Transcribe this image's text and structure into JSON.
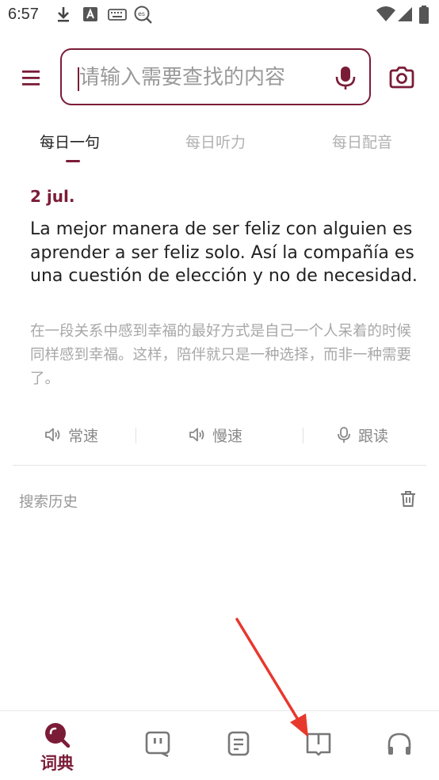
{
  "status_bar": {
    "time": "6:57"
  },
  "search": {
    "placeholder": "请输入需要查找的内容"
  },
  "tabs": [
    {
      "label": "每日一句",
      "active": true
    },
    {
      "label": "每日听力",
      "active": false
    },
    {
      "label": "每日配音",
      "active": false
    }
  ],
  "daily_sentence": {
    "date": "2 jul.",
    "sentence": "La mejor manera de ser feliz con alguien es aprender a ser feliz solo. Así la compañía es una cuestión de elección y no de necesidad.",
    "translation": "在一段关系中感到幸福的最好方式是自己一个人呆着的时候同样感到幸福。这样，陪伴就只是一种选择，而非一种需要了。",
    "actions": [
      {
        "label": "常速",
        "icon": "speaker-icon"
      },
      {
        "label": "慢速",
        "icon": "speaker-icon"
      },
      {
        "label": "跟读",
        "icon": "microphone-icon"
      }
    ]
  },
  "history": {
    "title": "搜索历史"
  },
  "bottom_nav": {
    "items": [
      {
        "label": "词典",
        "icon": "dictionary-search-icon",
        "active": true
      },
      {
        "label": "",
        "icon": "chat-bot-icon",
        "active": false
      },
      {
        "label": "",
        "icon": "document-icon",
        "active": false
      },
      {
        "label": "",
        "icon": "book-icon",
        "active": false
      },
      {
        "label": "",
        "icon": "headphones-icon",
        "active": false
      }
    ]
  },
  "colors": {
    "accent": "#7b1c37",
    "annotation_arrow": "#e8382d",
    "muted_text": "#a8a8a8"
  }
}
